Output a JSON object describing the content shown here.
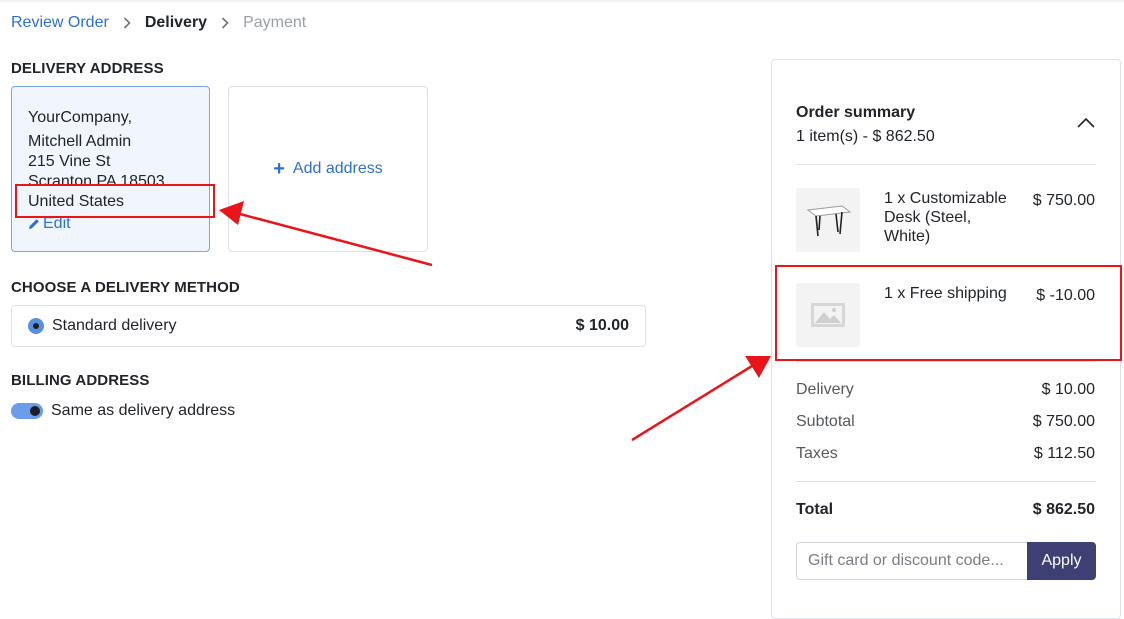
{
  "breadcrumb": {
    "review_order": "Review Order",
    "delivery": "Delivery",
    "payment": "Payment"
  },
  "delivery_address": {
    "title": "DELIVERY ADDRESS",
    "card": {
      "company": "YourCompany,",
      "name": "Mitchell Admin",
      "street": "215 Vine St",
      "city_line": "Scranton PA 18503",
      "country": "United States",
      "edit_label": "Edit"
    },
    "add_address_label": "Add address"
  },
  "delivery_method": {
    "title": "CHOOSE A DELIVERY METHOD",
    "options": [
      {
        "label": "Standard delivery",
        "price": "$ 10.00",
        "selected": true
      }
    ]
  },
  "billing": {
    "title": "BILLING ADDRESS",
    "same_as_delivery_label": "Same as delivery address",
    "same_as_delivery": true
  },
  "summary": {
    "title": "Order summary",
    "subtitle": "1 item(s) -  $ 862.50",
    "items": [
      {
        "name": "1 x Customizable Desk (Steel, White)",
        "price": "$ 750.00",
        "icon": "desk-image"
      },
      {
        "name": "1 x Free shipping",
        "price": "$ -10.00",
        "icon": "image-placeholder-icon"
      }
    ],
    "rows": [
      {
        "label": "Delivery",
        "value": "$ 10.00"
      },
      {
        "label": "Subtotal",
        "value": "$ 750.00"
      },
      {
        "label": "Taxes",
        "value": "$ 112.50"
      }
    ],
    "total_label": "Total",
    "total_value": "$ 862.50",
    "discount_placeholder": "Gift card or discount code...",
    "apply_label": "Apply"
  },
  "colors": {
    "link": "#2f6fd6",
    "apply_button": "#3e3f72",
    "annotation_red": "#e8161b",
    "selected_card_bg": "#f1f5fc"
  }
}
